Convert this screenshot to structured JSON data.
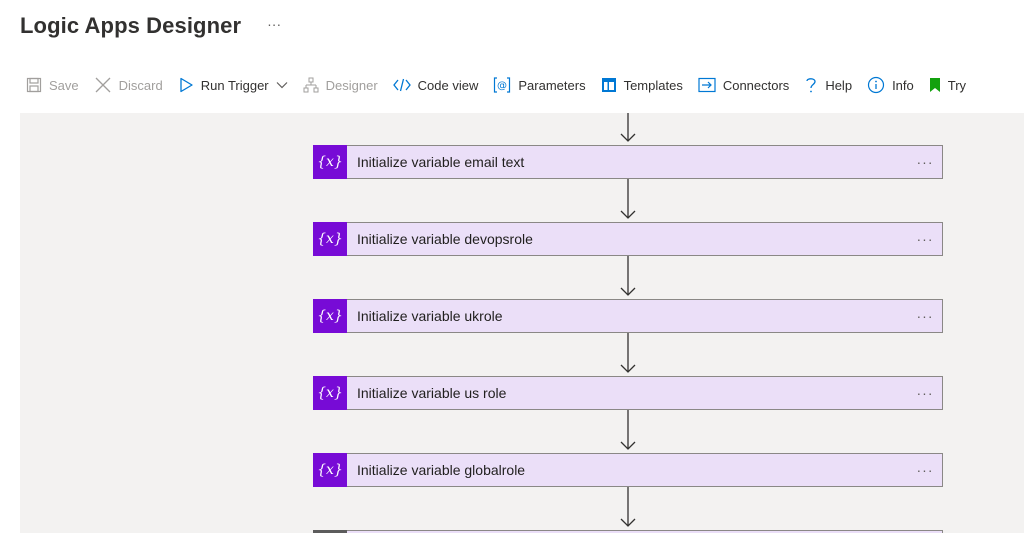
{
  "header": {
    "title": "Logic Apps Designer",
    "more": "···"
  },
  "toolbar": {
    "save": "Save",
    "discard": "Discard",
    "run_trigger": "Run Trigger",
    "designer": "Designer",
    "code_view": "Code view",
    "parameters": "Parameters",
    "templates": "Templates",
    "connectors": "Connectors",
    "help": "Help",
    "info": "Info",
    "try": "Try"
  },
  "canvas": {
    "steps": [
      {
        "title": "Initialize variable email text",
        "badge": "{x}",
        "more": "···"
      },
      {
        "title": "Initialize variable devopsrole",
        "badge": "{x}",
        "more": "···"
      },
      {
        "title": "Initialize variable ukrole",
        "badge": "{x}",
        "more": "···"
      },
      {
        "title": "Initialize variable us role",
        "badge": "{x}",
        "more": "···"
      },
      {
        "title": "Initialize variable globalrole",
        "badge": "{x}",
        "more": "···"
      }
    ]
  },
  "colors": {
    "accent": "#0078d4",
    "card_bg": "#ebdff8",
    "badge_bg": "#770bd6",
    "canvas_bg": "#f3f2f1",
    "try_icon": "#13a10e"
  }
}
